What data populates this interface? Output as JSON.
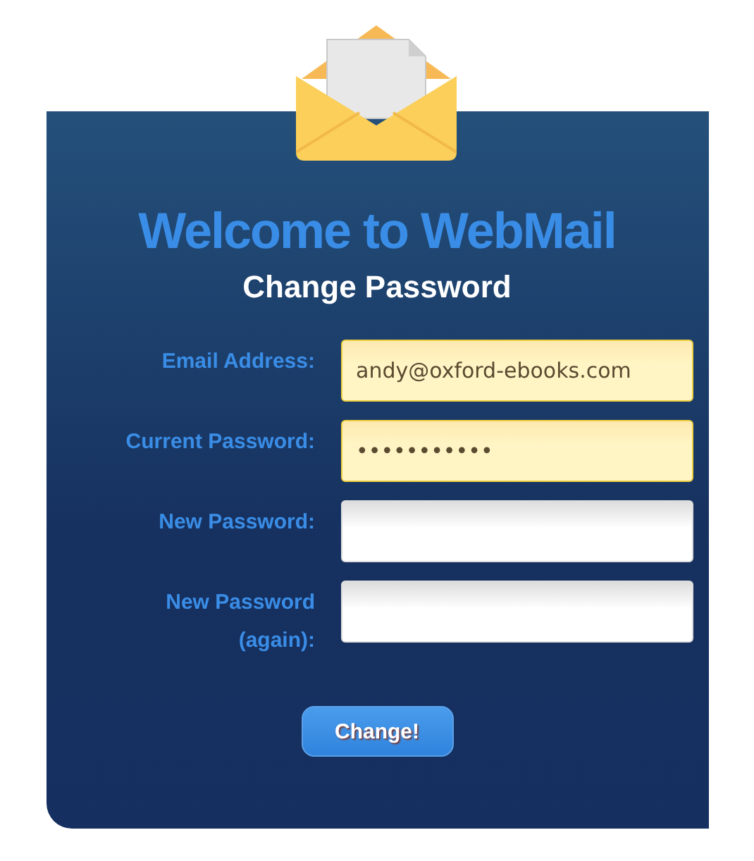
{
  "title": "Welcome to WebMail",
  "subtitle": "Change Password",
  "fields": [
    {
      "label": "Email Address:",
      "value": "andy@oxford-ebooks.com",
      "autofilled": true
    },
    {
      "label": "Current Password:",
      "value": "•••••••••••",
      "autofilled": true
    },
    {
      "label": "New Password:",
      "autofilled": false
    },
    {
      "label": "New Password (again):",
      "autofilled": false
    }
  ],
  "button": "Change!"
}
